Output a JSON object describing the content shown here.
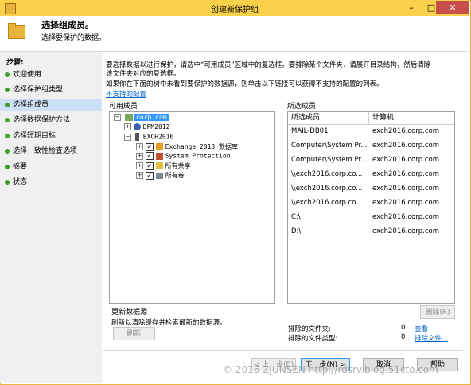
{
  "window": {
    "title": "创建新保护组"
  },
  "header": {
    "title": "选择组成员。",
    "subtitle": "选择要保护的数据。"
  },
  "sidebar": {
    "heading": "步骤:",
    "items": [
      {
        "label": "欢迎使用"
      },
      {
        "label": "选择保护组类型"
      },
      {
        "label": "选择组成员"
      },
      {
        "label": "选择数据保护方法"
      },
      {
        "label": "选择短期目标"
      },
      {
        "label": "选择一致性检查选项"
      },
      {
        "label": "摘要"
      },
      {
        "label": "状态"
      }
    ]
  },
  "main": {
    "instruction1": "要选择数据以进行保护，请选中“可用成员”区域中的复选框。要排除某个文件夹，请展开目录结构，然后清除",
    "instruction1b": "该文件夹对应的复选框。",
    "instruction2": "如果你在下面的树中未看到要保护的数据源，则单击以下链接可以获得不支持的配置的列表。",
    "unsupported_link": "不支持的配置",
    "available_label": "可用成员",
    "selected_label": "所选成员",
    "tree": {
      "root": "corp.com",
      "dpm": "DPM2012",
      "exch": "EXCH2016",
      "children": [
        "Exchange 2013 数据库",
        "System Protection",
        "所有共享",
        "所有卷"
      ]
    },
    "table": {
      "headers": [
        "所选成员",
        "计算机"
      ],
      "rows": [
        [
          "MAIL-DB01",
          "exch2016.corp.com"
        ],
        [
          "Computer\\System Pr...",
          "exch2016.corp.com"
        ],
        [
          "Computer\\System Pr...",
          "exch2016.corp.com"
        ],
        [
          "\\\\exch2016.corp.co...",
          "exch2016.corp.com"
        ],
        [
          "\\\\exch2016.corp.co...",
          "exch2016.corp.com"
        ],
        [
          "\\\\exch2016.corp.co...",
          "exch2016.corp.com"
        ],
        [
          "C:\\",
          "exch2016.corp.com"
        ],
        [
          "D:\\",
          "exch2016.corp.com"
        ]
      ]
    },
    "refresh_group_title": "更新数据源",
    "refresh_desc": "刷新以清除缓存并检索最新的数据源。",
    "refresh_button": "刷新",
    "remove_button": "删除(R)",
    "excluded_folders_label": "排除的文件夹:",
    "excluded_folders_count": "0",
    "view_link": "查看",
    "excluded_types_label": "排除的文件类型:",
    "excluded_types_count": "0",
    "exclude_files_link": "排除文件..."
  },
  "footer": {
    "back": "< 上一步(B)",
    "next": "下一步(N) >",
    "cancel": "取消",
    "help": "帮助",
    "watermark": "© 2016 ZJUNSEN http://rdsrv.blog.51cto.com"
  },
  "colors": {
    "titlebar": "#fbd14b",
    "close": "#c7504c",
    "selected_step": "#cde0f5",
    "step_dot": "#3ca024",
    "link": "#0066cc"
  }
}
